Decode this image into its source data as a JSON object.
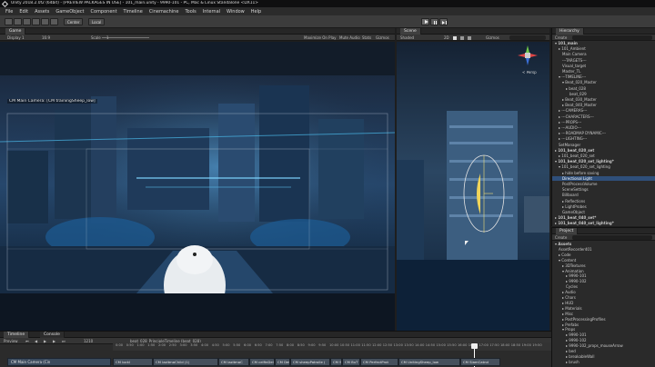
{
  "window": {
    "title": "Unity 2018.2.0f2 (64bit) - [PREVIEW PACKAGES IN USE] - 101_main.unity - 9990-101 - PC, Mac & Linux Standalone <DX11>"
  },
  "menu": [
    "File",
    "Edit",
    "Assets",
    "GameObject",
    "Component",
    "Timeline",
    "Cinemachine",
    "Tools",
    "Internal",
    "Window",
    "Help"
  ],
  "toolbar": {
    "center_label": "Center",
    "local_label": "Local"
  },
  "game": {
    "tab": "Game",
    "display": "Display 1",
    "aspect": "16:9",
    "scale_label": "Scale",
    "scale_value": "1",
    "maximize_on_play": "Maximize On Play",
    "mute_audio": "Mute Audio",
    "stats": "Stats",
    "gizmos": "Gizmos",
    "camera_overlay": "CM Main Camera: [CM trainingSheep_low]"
  },
  "scene": {
    "tab": "Scene",
    "shading": "Shaded",
    "mode": "2D",
    "gizmos": "Gizmos",
    "persp": "< Persp"
  },
  "hierarchy": {
    "tab": "Hierarchy",
    "create": "Create",
    "rows": [
      {
        "label": "▾ 101_main",
        "indent": 0,
        "sel": false,
        "bold": true
      },
      {
        "label": "▸ 101_Ambient",
        "indent": 1,
        "sel": false,
        "bold": false
      },
      {
        "label": "Main Camera",
        "indent": 2,
        "sel": false,
        "bold": false
      },
      {
        "label": "---TARGETS---",
        "indent": 2,
        "sel": false,
        "bold": false
      },
      {
        "label": "Visual_target",
        "indent": 2,
        "sel": false,
        "bold": false
      },
      {
        "label": "Master_TL",
        "indent": 2,
        "sel": false,
        "bold": false
      },
      {
        "label": "▾ ---TIMELINE---",
        "indent": 1,
        "sel": false,
        "bold": false
      },
      {
        "label": "▾ Beat_020_Master",
        "indent": 2,
        "sel": false,
        "bold": false
      },
      {
        "label": "▸ beat_028",
        "indent": 3,
        "sel": false,
        "bold": false
      },
      {
        "label": "beat_029",
        "indent": 4,
        "sel": false,
        "bold": false
      },
      {
        "label": "▸ Beat_030_Master",
        "indent": 2,
        "sel": false,
        "bold": false
      },
      {
        "label": "▸ Beat_040_Master",
        "indent": 2,
        "sel": false,
        "bold": false
      },
      {
        "label": "▸ ---CAMERAS---",
        "indent": 1,
        "sel": false,
        "bold": false
      },
      {
        "label": "▸ ---CHARACTERS---",
        "indent": 1,
        "sel": false,
        "bold": false
      },
      {
        "label": "▸ ---PROPS---",
        "indent": 1,
        "sel": false,
        "bold": false
      },
      {
        "label": "▸ ---AUDIO---",
        "indent": 1,
        "sel": false,
        "bold": false
      },
      {
        "label": "▸ ---ROADMAP DYNAMIC---",
        "indent": 1,
        "sel": false,
        "bold": false
      },
      {
        "label": "▸ ---LIGHTING---",
        "indent": 1,
        "sel": false,
        "bold": false
      },
      {
        "label": "SetManager",
        "indent": 1,
        "sel": false,
        "bold": false
      },
      {
        "label": "▸ 101_beat_020_set",
        "indent": 0,
        "sel": false,
        "bold": true
      },
      {
        "label": "▸ 101_beat_020_set",
        "indent": 1,
        "sel": false,
        "bold": false
      },
      {
        "label": "▾ 101_beat_020_set_lighting*",
        "indent": 0,
        "sel": false,
        "bold": true
      },
      {
        "label": "▾ 101_beat_020_set_lighting",
        "indent": 1,
        "sel": false,
        "bold": false
      },
      {
        "label": "▸ hide before saving",
        "indent": 2,
        "sel": false,
        "bold": false
      },
      {
        "label": "Directional Light",
        "indent": 2,
        "sel": true,
        "bold": false
      },
      {
        "label": "PostProcessVolume",
        "indent": 2,
        "sel": false,
        "bold": false
      },
      {
        "label": "SceneSettings",
        "indent": 2,
        "sel": false,
        "bold": false
      },
      {
        "label": "Billboard",
        "indent": 2,
        "sel": false,
        "bold": false
      },
      {
        "label": "▸ Reflections",
        "indent": 2,
        "sel": false,
        "bold": false
      },
      {
        "label": "▸ LightProbes",
        "indent": 2,
        "sel": false,
        "bold": false
      },
      {
        "label": "GameObject",
        "indent": 2,
        "sel": false,
        "bold": false
      },
      {
        "label": "▸ 101_beat_040_set*",
        "indent": 0,
        "sel": false,
        "bold": true
      },
      {
        "label": "▸ 101_beat_040_set_lighting*",
        "indent": 0,
        "sel": false,
        "bold": true
      }
    ]
  },
  "project": {
    "tab": "Project",
    "create": "Create",
    "rows": [
      {
        "label": "▾ Assets",
        "indent": 0,
        "bold": true
      },
      {
        "label": "AssetRecorder401",
        "indent": 1,
        "bold": false
      },
      {
        "label": "▸ Code",
        "indent": 1,
        "bold": false
      },
      {
        "label": "▾ Content",
        "indent": 1,
        "bold": false
      },
      {
        "label": "▸ 3DTextures",
        "indent": 2,
        "bold": false
      },
      {
        "label": "▾ Animation",
        "indent": 2,
        "bold": false
      },
      {
        "label": "▸ 9990-101",
        "indent": 3,
        "bold": false
      },
      {
        "label": "▸ 9990-102",
        "indent": 3,
        "bold": false
      },
      {
        "label": "Cycles",
        "indent": 3,
        "bold": false
      },
      {
        "label": "▸ Audio",
        "indent": 2,
        "bold": false
      },
      {
        "label": "▸ Chars",
        "indent": 2,
        "bold": false
      },
      {
        "label": "▸ HUD",
        "indent": 2,
        "bold": false
      },
      {
        "label": "▸ Materials",
        "indent": 2,
        "bold": false
      },
      {
        "label": "▸ Misc",
        "indent": 2,
        "bold": false
      },
      {
        "label": "▸ PostProcessingProfiles",
        "indent": 2,
        "bold": false
      },
      {
        "label": "▸ Prefabs",
        "indent": 2,
        "bold": false
      },
      {
        "label": "▾ Props",
        "indent": 2,
        "bold": false
      },
      {
        "label": "▸ 9990-101",
        "indent": 3,
        "bold": false
      },
      {
        "label": "▸ 9990-102",
        "indent": 3,
        "bold": false
      },
      {
        "label": "▸ 9990-102_props_mouseArrow",
        "indent": 3,
        "bold": false
      },
      {
        "label": "▸ bed",
        "indent": 3,
        "bold": false
      },
      {
        "label": "▸ breakableWall",
        "indent": 3,
        "bold": false
      },
      {
        "label": "▸ brush",
        "indent": 3,
        "bold": false
      }
    ]
  },
  "timeline": {
    "tab": "Timeline",
    "console_tab": "Console",
    "preview": "Preview",
    "frame": "1210",
    "asset": "beat_028_PrincipleTimeline (beat_028)",
    "ticks": [
      "0:00",
      "0:50",
      "1:00",
      "1:50",
      "2:00",
      "2:50",
      "3:00",
      "3:50",
      "4:00",
      "4:50",
      "5:00",
      "5:50",
      "6:00",
      "6:50",
      "7:00",
      "7:50",
      "8:00",
      "8:50",
      "9:00",
      "9:50",
      "10:00",
      "10:50",
      "11:00",
      "11:50",
      "12:00",
      "12:50",
      "13:00",
      "13:50",
      "14:00",
      "14:50",
      "15:00",
      "15:50",
      "16:00",
      "16:50",
      "17:00",
      "17:50",
      "18:00",
      "18:50",
      "19:00",
      "19:50"
    ],
    "track": "CM Main Camera (Cin",
    "clips": [
      "CM lockI",
      "CM lazitmaChild (1)",
      "CM lazitmaC",
      "CM celfinDelu",
      "CM Delu",
      "CM sheepPatrolle (",
      "CM Sla",
      "CM BuT",
      "CM PerfectProt",
      "CM UnitingSheep_low",
      "CM SlamCatnd"
    ]
  }
}
